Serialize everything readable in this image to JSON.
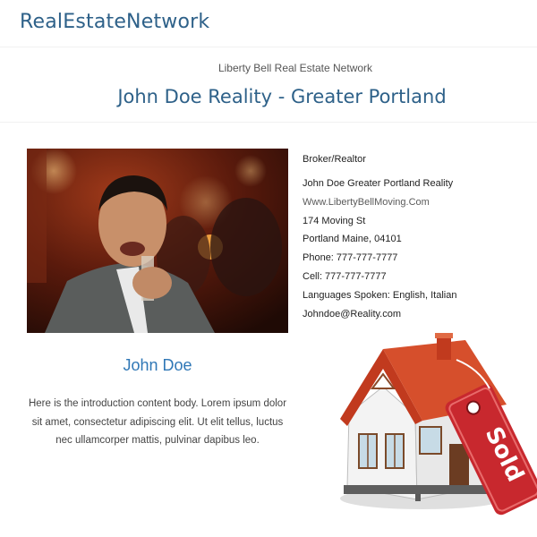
{
  "site": {
    "brand": "RealEstateNetwork",
    "brand_color": "#2e6189"
  },
  "header": {
    "network_name": "Liberty Bell Real Estate Network",
    "agency_title": "John Doe Reality - Greater Portland"
  },
  "agent": {
    "role": "Broker/Realtor",
    "company": "John Doe Greater Portland Reality",
    "website": "Www.LibertyBellMoving.Com",
    "street": "174 Moving St",
    "city_line": "Portland Maine, 04101",
    "phone": "Phone: 777-777-7777",
    "cell": "Cell: 777-777-7777",
    "languages": "Languages Spoken: English, Italian",
    "email": "Johndoe@Reality.com",
    "name": "John Doe",
    "name_color": "#2f77b6",
    "intro": "Here is the introduction content body. Lorem ipsum dolor sit amet, consectetur adipiscing elit. Ut elit tellus, luctus nec ullamcorper mattis, pulvinar dapibus leo."
  },
  "sold_graphic": {
    "tag_text": "Sold",
    "tag_color": "#c8282e",
    "roof_color": "#c13a1e"
  }
}
